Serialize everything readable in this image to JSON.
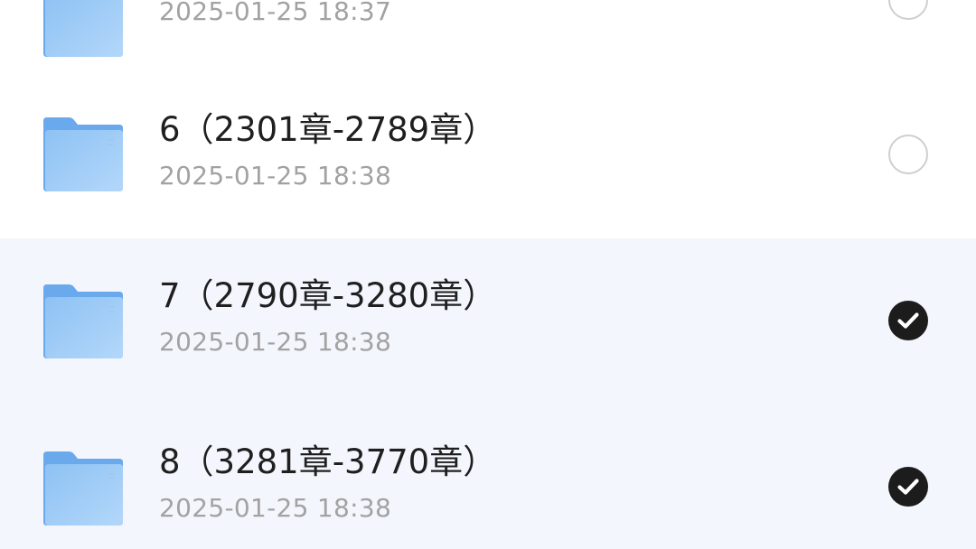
{
  "colors": {
    "folder": "#7db6ef",
    "selected_row_bg": "#f3f6fc",
    "check_on": "#1c1c1c",
    "check_off_border": "#cfcfcf",
    "date_text": "#a2a2a2"
  },
  "folders": [
    {
      "name": "",
      "date": "2025-01-25 18:37",
      "selected": false,
      "icon": "folder-icon"
    },
    {
      "name": "6（2301章-2789章）",
      "date": "2025-01-25 18:38",
      "selected": false,
      "icon": "folder-icon"
    },
    {
      "name": "7（2790章-3280章）",
      "date": "2025-01-25 18:38",
      "selected": true,
      "icon": "folder-icon"
    },
    {
      "name": "8（3281章-3770章）",
      "date": "2025-01-25 18:38",
      "selected": true,
      "icon": "folder-icon"
    }
  ]
}
